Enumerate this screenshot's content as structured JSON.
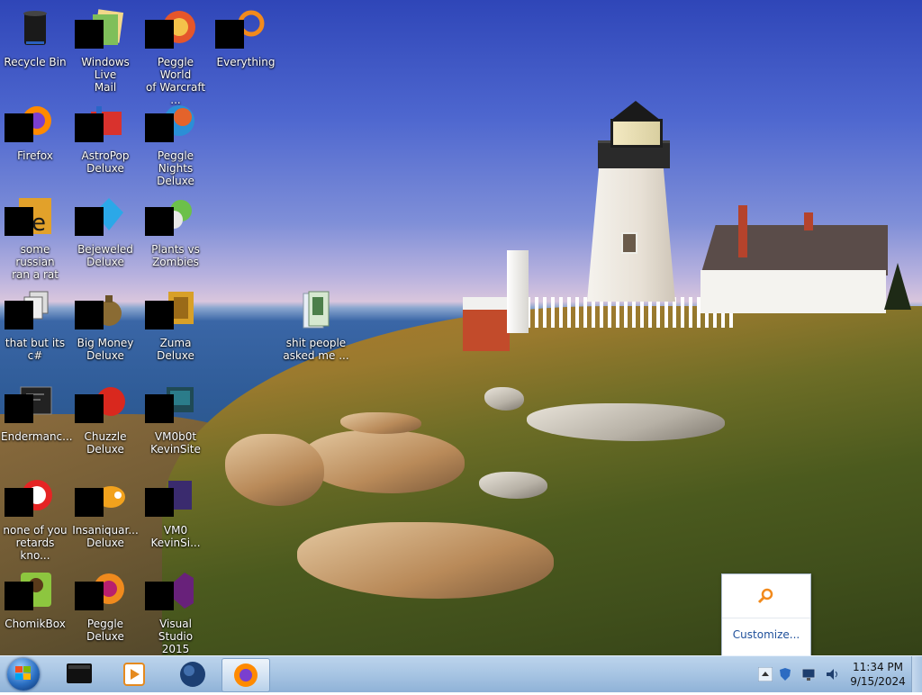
{
  "desktop": {
    "icons": [
      {
        "label": "Recycle Bin"
      },
      {
        "label": "Windows Live\nMail"
      },
      {
        "label": "Peggle World\nof Warcraft ..."
      },
      {
        "label": "Everything"
      },
      {
        "label": "Firefox"
      },
      {
        "label": "AstroPop\nDeluxe"
      },
      {
        "label": "Peggle Nights\nDeluxe"
      },
      {
        "label": "some russian\nran a rat"
      },
      {
        "label": "Bejeweled\nDeluxe"
      },
      {
        "label": "Plants vs\nZombies"
      },
      {
        "label": "that but its c#"
      },
      {
        "label": "Big Money\nDeluxe"
      },
      {
        "label": "Zuma Deluxe"
      },
      {
        "label": "shit people\nasked me ..."
      },
      {
        "label": "Endermanc..."
      },
      {
        "label": "Chuzzle\nDeluxe"
      },
      {
        "label": "VM0b0t\nKevinSite"
      },
      {
        "label": "none of you\nretards kno..."
      },
      {
        "label": "Insaniquar...\nDeluxe"
      },
      {
        "label": "VM0\nKevinSi..."
      },
      {
        "label": "ChomikBox"
      },
      {
        "label": "Peggle Deluxe"
      },
      {
        "label": "Visual Studio\n2015"
      }
    ]
  },
  "popup": {
    "customize_label": "Customize..."
  },
  "taskbar": {
    "clock_time": "11:34 PM",
    "clock_date": "9/15/2024"
  }
}
